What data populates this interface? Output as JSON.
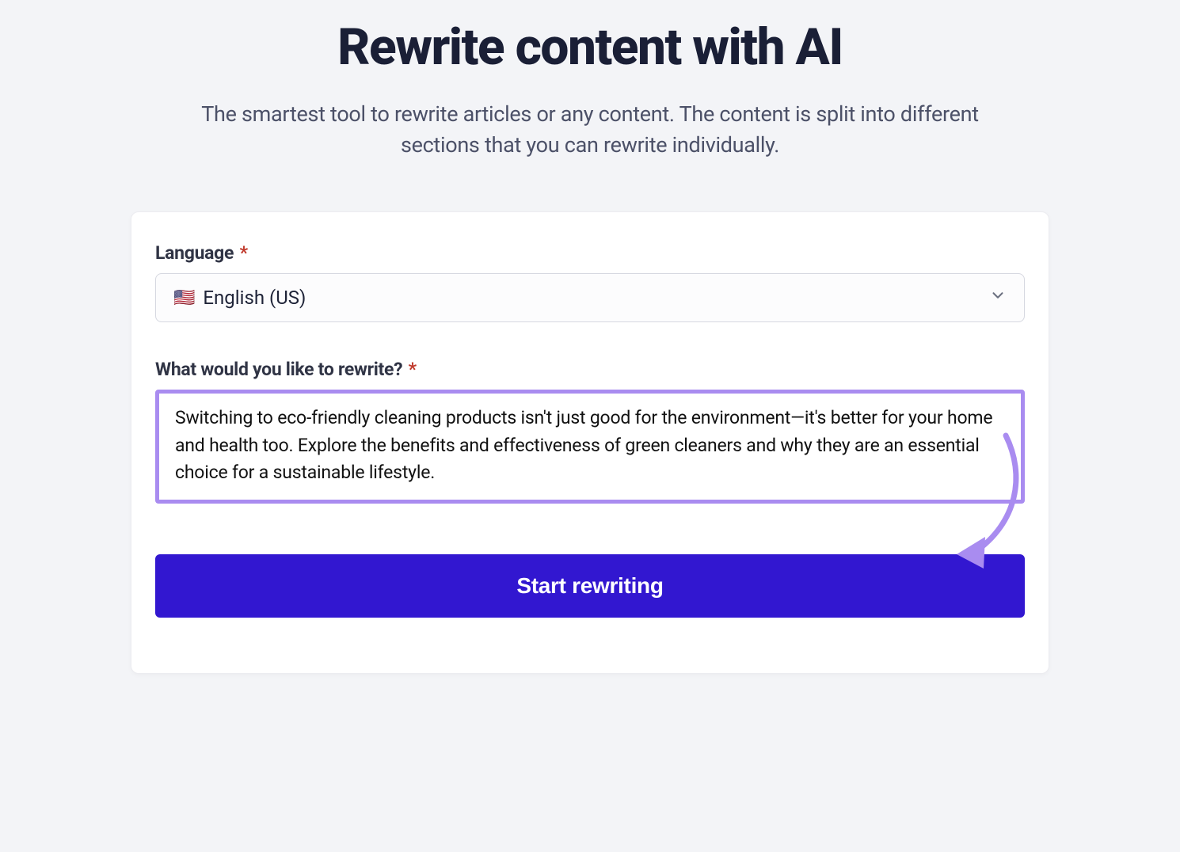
{
  "header": {
    "title": "Rewrite content with AI",
    "subtitle": "The smartest tool to rewrite articles or any content. The content is split into different sections that you can rewrite individually."
  },
  "form": {
    "language": {
      "label": "Language",
      "required": "*",
      "flag": "🇺🇸",
      "selected": "English (US)"
    },
    "content": {
      "label": "What would you like to rewrite?",
      "required": "*",
      "value": "Switching to eco-friendly cleaning products isn't just good for the environment—it's better for your home and health too. Explore the benefits and effectiveness of green cleaners and why they are an essential choice for a sustainable lifestyle."
    },
    "submit_label": "Start rewriting"
  },
  "colors": {
    "accent": "#3217d0",
    "highlight_border": "#a98cf0",
    "annotation": "#a98cf0"
  }
}
